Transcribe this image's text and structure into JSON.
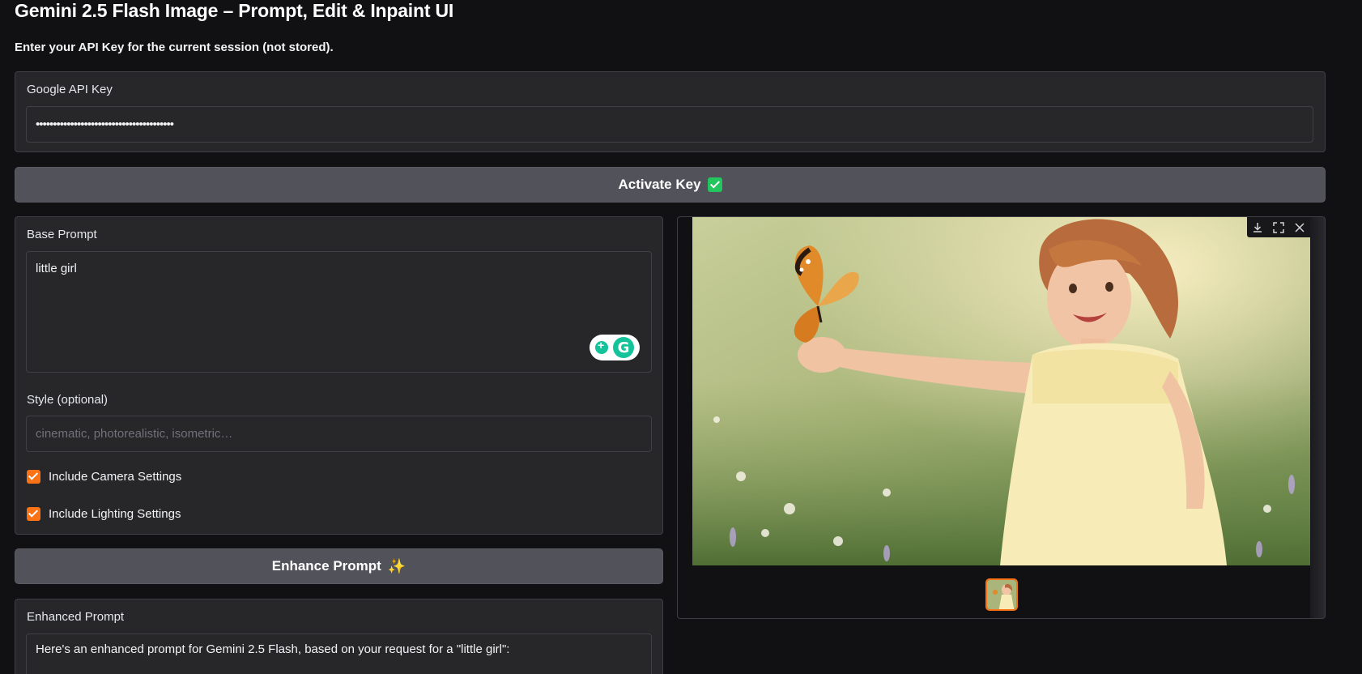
{
  "header": {
    "title": "Gemini 2.5 Flash Image – Prompt, Edit & Inpaint UI",
    "subtitle": "Enter your API Key for the current session (not stored)."
  },
  "api_key": {
    "label": "Google API Key",
    "value": "••••••••••••••••••••••••••••••••••••••••"
  },
  "activate_button": {
    "label": "Activate Key"
  },
  "base_prompt": {
    "label": "Base Prompt",
    "value": "little girl"
  },
  "style": {
    "label": "Style (optional)",
    "placeholder": "cinematic, photorealistic, isometric…"
  },
  "options": [
    {
      "label": "Include Camera Settings",
      "checked": true
    },
    {
      "label": "Include Lighting Settings",
      "checked": true
    }
  ],
  "enhance_button": {
    "label": "Enhance Prompt",
    "icon": "sparkles-icon"
  },
  "enhanced_prompt": {
    "label": "Enhanced Prompt",
    "value": "Here's an enhanced prompt for Gemini 2.5 Flash, based on your request for a \"little girl\":"
  },
  "image_viewer": {
    "toolbar_icons": [
      "download-icon",
      "fullscreen-icon",
      "close-icon"
    ]
  },
  "colors": {
    "accent": "#f97316",
    "button_bg": "#52525b",
    "panel_bg": "#27272a",
    "page_bg": "#111114"
  }
}
